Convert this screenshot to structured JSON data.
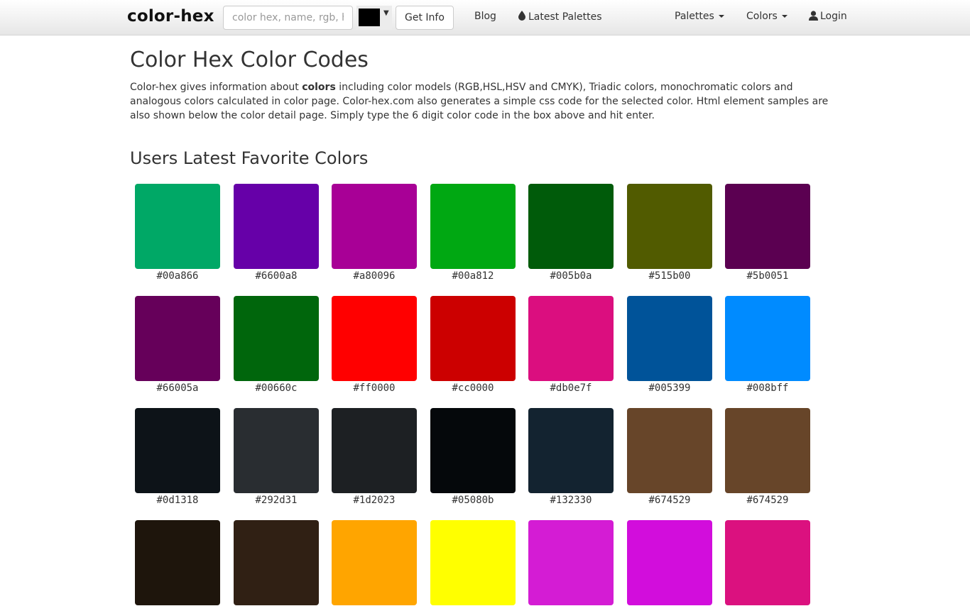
{
  "navbar": {
    "brand": "color-hex",
    "search_placeholder": "color hex, name, rgb, hsl",
    "picker_color": "#000000",
    "picker_arrow": "▼",
    "get_info_label": "Get Info",
    "links": {
      "blog": "Blog",
      "latest_palettes": "Latest Palettes",
      "palettes": "Palettes",
      "colors": "Colors",
      "login": "Login"
    }
  },
  "main": {
    "title": "Color Hex Color Codes",
    "intro_before": "Color-hex gives information about ",
    "intro_bold": "colors",
    "intro_after": " including color models (RGB,HSL,HSV and CMYK), Triadic colors, monochromatic colors and analogous colors calculated in color page. Color-hex.com also generates a simple css code for the selected color. Html element samples are also shown below the color detail page. Simply type the 6 digit color code in the box above and hit enter.",
    "favorites_title": "Users Latest Favorite Colors",
    "colors": [
      {
        "hex": "#00a866",
        "label": "#00a866"
      },
      {
        "hex": "#6600a8",
        "label": "#6600a8"
      },
      {
        "hex": "#a80096",
        "label": "#a80096"
      },
      {
        "hex": "#00a812",
        "label": "#00a812"
      },
      {
        "hex": "#005b0a",
        "label": "#005b0a"
      },
      {
        "hex": "#515b00",
        "label": "#515b00"
      },
      {
        "hex": "#5b0051",
        "label": "#5b0051"
      },
      {
        "hex": "#66005a",
        "label": "#66005a"
      },
      {
        "hex": "#00660c",
        "label": "#00660c"
      },
      {
        "hex": "#ff0000",
        "label": "#ff0000"
      },
      {
        "hex": "#cc0000",
        "label": "#cc0000"
      },
      {
        "hex": "#db0e7f",
        "label": "#db0e7f"
      },
      {
        "hex": "#005399",
        "label": "#005399"
      },
      {
        "hex": "#008bff",
        "label": "#008bff"
      },
      {
        "hex": "#0d1318",
        "label": "#0d1318"
      },
      {
        "hex": "#292d31",
        "label": "#292d31"
      },
      {
        "hex": "#1d2023",
        "label": "#1d2023"
      },
      {
        "hex": "#05080b",
        "label": "#05080b"
      },
      {
        "hex": "#132330",
        "label": "#132330"
      },
      {
        "hex": "#674529",
        "label": "#674529"
      },
      {
        "hex": "#674529",
        "label": "#674529"
      },
      {
        "hex": "#1e150c",
        "label": ""
      },
      {
        "hex": "#302014",
        "label": ""
      },
      {
        "hex": "#ffa500",
        "label": ""
      },
      {
        "hex": "#ffff00",
        "label": ""
      },
      {
        "hex": "#d41cd4",
        "label": ""
      },
      {
        "hex": "#d20ddc",
        "label": ""
      },
      {
        "hex": "#db117f",
        "label": ""
      }
    ]
  }
}
